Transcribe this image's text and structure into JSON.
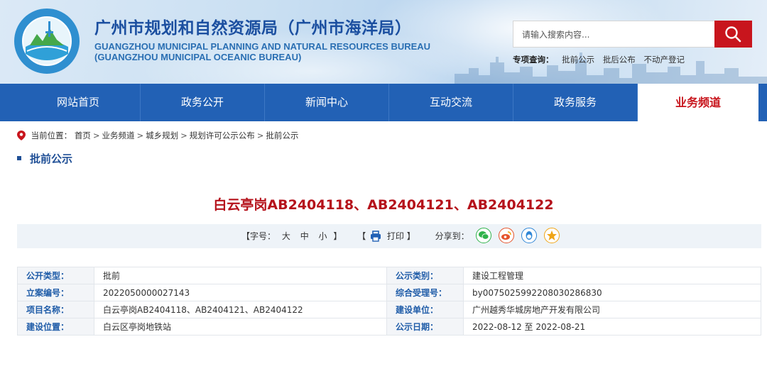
{
  "header": {
    "title_cn": "广州市规划和自然资源局（广州市海洋局）",
    "title_en_line1": "GUANGZHOU MUNICIPAL PLANNING AND NATURAL RESOURCES BUREAU",
    "title_en_line2": "(GUANGZHOU MUNICIPAL OCEANIC BUREAU)",
    "logo_text": "广州市规划和自然资源局"
  },
  "search": {
    "placeholder": "请输入搜索内容..."
  },
  "quick_search": {
    "label": "专项查询：",
    "links": [
      "批前公示",
      "批后公布",
      "不动产登记"
    ]
  },
  "nav": {
    "items": [
      {
        "label": "网站首页",
        "active": false
      },
      {
        "label": "政务公开",
        "active": false
      },
      {
        "label": "新闻中心",
        "active": false
      },
      {
        "label": "互动交流",
        "active": false
      },
      {
        "label": "政务服务",
        "active": false
      },
      {
        "label": "业务频道",
        "active": true
      }
    ]
  },
  "breadcrumb": {
    "prefix": "当前位置：",
    "items": [
      "首页",
      "业务频道",
      "城乡规划",
      "规划许可公示公布",
      "批前公示"
    ],
    "separator": ">"
  },
  "section_title": "批前公示",
  "article": {
    "title": "白云亭岗AB2404118、AB2404121、AB2404122"
  },
  "tools": {
    "font_label_open": "【字号：",
    "font_large": "大",
    "font_medium": "中",
    "font_small": "小",
    "font_label_close": "】",
    "print_open": "【",
    "print_label": "打印",
    "print_close": "】",
    "share_label": "分享到："
  },
  "info": {
    "rows": [
      {
        "k1": "公开类型：",
        "v1": "批前",
        "k2": "公示类别：",
        "v2": "建设工程管理"
      },
      {
        "k1": "立案编号：",
        "v1": "2022050000027143",
        "k2": "综合受理号：",
        "v2": "by0075025992208030286830"
      },
      {
        "k1": "项目名称：",
        "v1": "白云亭岗AB2404118、AB2404121、AB2404122",
        "k2": "建设单位：",
        "v2": "广州越秀华城房地产开发有限公司"
      },
      {
        "k1": "建设位置：",
        "v1": "白云区亭岗地铁站",
        "k2": "公示日期：",
        "v2": "2022-08-12 至 2022-08-21"
      }
    ]
  },
  "colors": {
    "brand_blue": "#2261b5",
    "accent_red": "#c8151d",
    "title_red": "#b5121b"
  }
}
